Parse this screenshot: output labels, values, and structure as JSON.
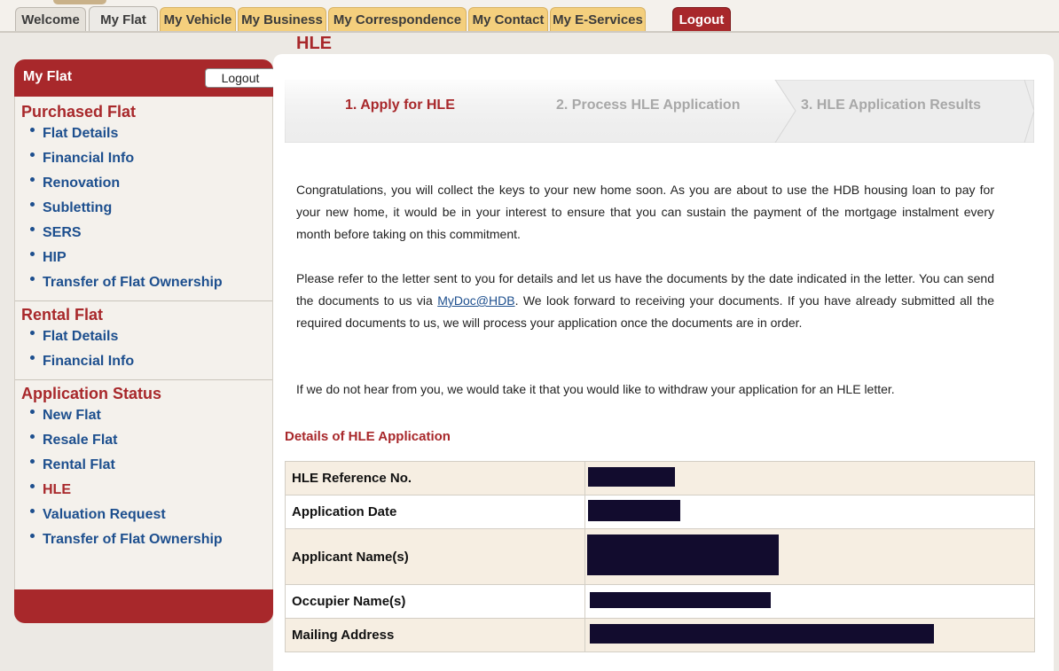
{
  "top_tabs": [
    {
      "label": "Welcome"
    },
    {
      "label": "My Flat"
    },
    {
      "label": "My Vehicle"
    },
    {
      "label": "My Business"
    },
    {
      "label": "My Correspondence"
    },
    {
      "label": "My Contact"
    },
    {
      "label": "My E-Services"
    },
    {
      "label": "Logout"
    }
  ],
  "page_title": "HLE",
  "sidebar": {
    "title": "My Flat",
    "logout_label": "Logout",
    "sections": [
      {
        "title": "Purchased Flat",
        "items": [
          "Flat Details",
          "Financial Info",
          "Renovation",
          "Subletting",
          "SERS",
          "HIP",
          "Transfer of Flat Ownership"
        ]
      },
      {
        "title": "Rental Flat",
        "items": [
          "Flat Details",
          "Financial Info"
        ]
      },
      {
        "title": "Application Status",
        "items": [
          "New Flat",
          "Resale Flat",
          "Rental Flat",
          "HLE",
          "Valuation Request",
          "Transfer of Flat Ownership"
        ]
      }
    ]
  },
  "stepper": {
    "steps": [
      {
        "label": "1. Apply for HLE",
        "state": "active"
      },
      {
        "label": "2. Process HLE Application",
        "state": "inactive"
      },
      {
        "label": "3. HLE Application Results",
        "state": "inactive"
      }
    ]
  },
  "content": {
    "para1": "Congratulations, you will collect the keys to your new home soon. As you are about to use the HDB housing loan to pay for your new home, it would be in your interest to ensure that you can sustain the payment of the mortgage instalment every month before taking on this commitment.",
    "para2_before_link": "Please refer to the letter sent to you for details and let us have the documents by the date indicated in the letter. You can send the documents to us via ",
    "para2_link": "MyDoc@HDB",
    "para2_after_link": ". We look forward to receiving your documents. If you have already submitted all the required documents to us, we will process your application once the documents are in order.",
    "para3": "If we do not hear from you, we would take it that you would like to withdraw your application for an HLE letter."
  },
  "details": {
    "heading": "Details of HLE Application",
    "rows": [
      {
        "label": "HLE Reference No.",
        "value": "[redacted]"
      },
      {
        "label": "Application Date",
        "value": "[redacted]"
      },
      {
        "label": "Applicant Name(s)",
        "value": "[redacted]"
      },
      {
        "label": "Occupier Name(s)",
        "value": "[redacted]"
      },
      {
        "label": "Mailing Address",
        "value": "[redacted]"
      }
    ]
  },
  "colors": {
    "brand_red": "#a8282b",
    "link_blue": "#1d4f8e",
    "tab_gold": "#f4cf7d",
    "row_shade": "#f6eee2",
    "redaction": "#120c2e"
  }
}
